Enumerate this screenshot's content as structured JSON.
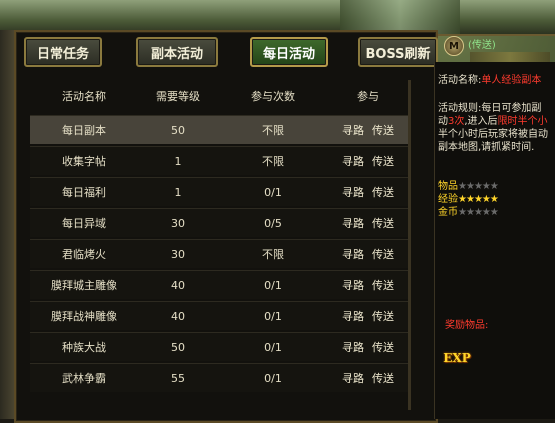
{
  "tabs": [
    {
      "label": "日常任务"
    },
    {
      "label": "副本活动"
    },
    {
      "label": "每日活动"
    },
    {
      "label": "BOSS刷新"
    }
  ],
  "top_right": {
    "text": "(传送)",
    "icon": "M"
  },
  "table": {
    "headers": [
      "活动名称",
      "需要等级",
      "参与次数",
      "参与"
    ],
    "rows": [
      {
        "name": "每日副本",
        "level": "50",
        "count": "不限",
        "a": "寻路",
        "b": "传送"
      },
      {
        "name": "收集字帖",
        "level": "1",
        "count": "不限",
        "a": "寻路",
        "b": "传送"
      },
      {
        "name": "每日福利",
        "level": "1",
        "count": "0/1",
        "a": "寻路",
        "b": "传送"
      },
      {
        "name": "每日异域",
        "level": "30",
        "count": "0/5",
        "a": "寻路",
        "b": "传送"
      },
      {
        "name": "君临烤火",
        "level": "30",
        "count": "不限",
        "a": "寻路",
        "b": "传送"
      },
      {
        "name": "膜拜城主雕像",
        "level": "40",
        "count": "0/1",
        "a": "寻路",
        "b": "传送"
      },
      {
        "name": "膜拜战神雕像",
        "level": "40",
        "count": "0/1",
        "a": "寻路",
        "b": "传送"
      },
      {
        "name": "种族大战",
        "level": "50",
        "count": "0/1",
        "a": "寻路",
        "b": "传送"
      },
      {
        "name": "武林争霸",
        "level": "55",
        "count": "0/1",
        "a": "寻路",
        "b": "传送"
      }
    ]
  },
  "info": {
    "name_label": "活动名称:",
    "name_value": "单人经验副本",
    "rule_label": "活动规则:",
    "rule_line1": "每日可参加副",
    "rule_line2a": "动",
    "rule_line2b": "3次",
    "rule_line2c": ",进入后",
    "rule_line2d": "限时半个小",
    "rule_line3": "半个小时后玩家将被自动",
    "rule_line4": "副本地图,请抓紧时间.",
    "items_label": "物品",
    "items_stars": 0,
    "exp_label": "经验",
    "exp_stars": 5,
    "gold_label": "金币",
    "gold_stars": 0,
    "reward_label": "奖励物品:",
    "exp_icon": "EXP"
  },
  "colors": {
    "highlight": "#ff3b2e",
    "gold": "#ffd52a",
    "green": "#9ed05a"
  }
}
